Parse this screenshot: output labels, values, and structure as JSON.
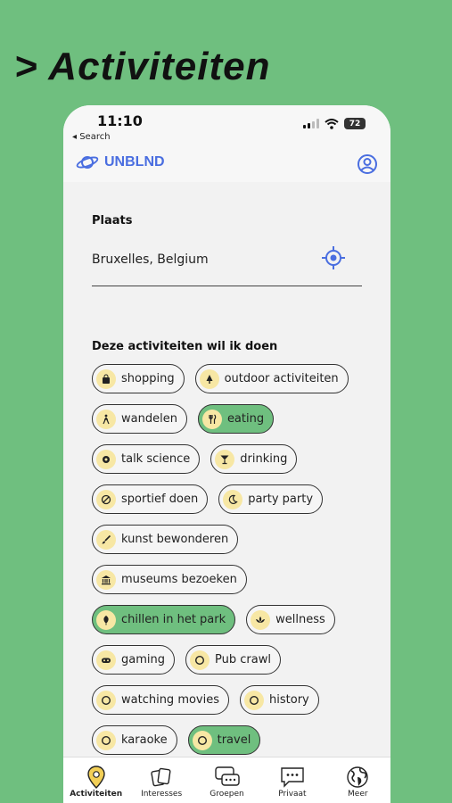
{
  "headline": "> Activiteiten",
  "status": {
    "time": "11:10",
    "back": "◂ Search",
    "battery": "72"
  },
  "app": {
    "name": "UNBLND"
  },
  "form": {
    "place_label": "Plaats",
    "place_value": "Bruxelles, Belgium",
    "activities_title": "Deze activiteiten wil ik doen"
  },
  "chips": [
    [
      {
        "label": "shopping",
        "icon": "bag-icon",
        "selected": false
      },
      {
        "label": "outdoor activiteiten",
        "icon": "tree-icon",
        "selected": false
      }
    ],
    [
      {
        "label": "wandelen",
        "icon": "hiker-icon",
        "selected": false
      },
      {
        "label": "eating",
        "icon": "cutlery-icon",
        "selected": true
      }
    ],
    [
      {
        "label": "talk science",
        "icon": "gear-icon",
        "selected": false
      },
      {
        "label": "drinking",
        "icon": "cocktail-icon",
        "selected": false
      }
    ],
    [
      {
        "label": "sportief doen",
        "icon": "ball-icon",
        "selected": false
      },
      {
        "label": "party party",
        "icon": "moon-icon",
        "selected": false
      }
    ],
    [
      {
        "label": "kunst bewonderen",
        "icon": "brush-icon",
        "selected": false
      }
    ],
    [
      {
        "label": "museums bezoeken",
        "icon": "museum-icon",
        "selected": false
      }
    ],
    [
      {
        "label": "chillen in het park",
        "icon": "leaf-icon",
        "selected": true
      },
      {
        "label": "wellness",
        "icon": "lotus-icon",
        "selected": false
      }
    ],
    [
      {
        "label": "gaming",
        "icon": "gamepad-icon",
        "selected": false
      },
      {
        "label": "Pub crawl",
        "icon": "circle-icon",
        "selected": false
      }
    ],
    [
      {
        "label": "watching movies",
        "icon": "circle-icon",
        "selected": false
      },
      {
        "label": "history",
        "icon": "circle-icon",
        "selected": false
      }
    ],
    [
      {
        "label": "karaoke",
        "icon": "circle-icon",
        "selected": false
      },
      {
        "label": "travel",
        "icon": "circle-icon",
        "selected": true
      }
    ]
  ],
  "tabs": [
    {
      "label": "Activiteiten",
      "icon": "map-pin-icon",
      "active": true
    },
    {
      "label": "Interesses",
      "icon": "cards-icon",
      "active": false
    },
    {
      "label": "Groepen",
      "icon": "chat-icon",
      "active": false
    },
    {
      "label": "Privaat",
      "icon": "message-icon",
      "active": false
    },
    {
      "label": "Meer",
      "icon": "globe-icon",
      "active": false
    }
  ],
  "colors": {
    "background": "#6fbf7f",
    "accent": "#4a6ee0",
    "chip_icon_bg": "#f7e7a4",
    "selected_chip": "#6fbf7f"
  }
}
